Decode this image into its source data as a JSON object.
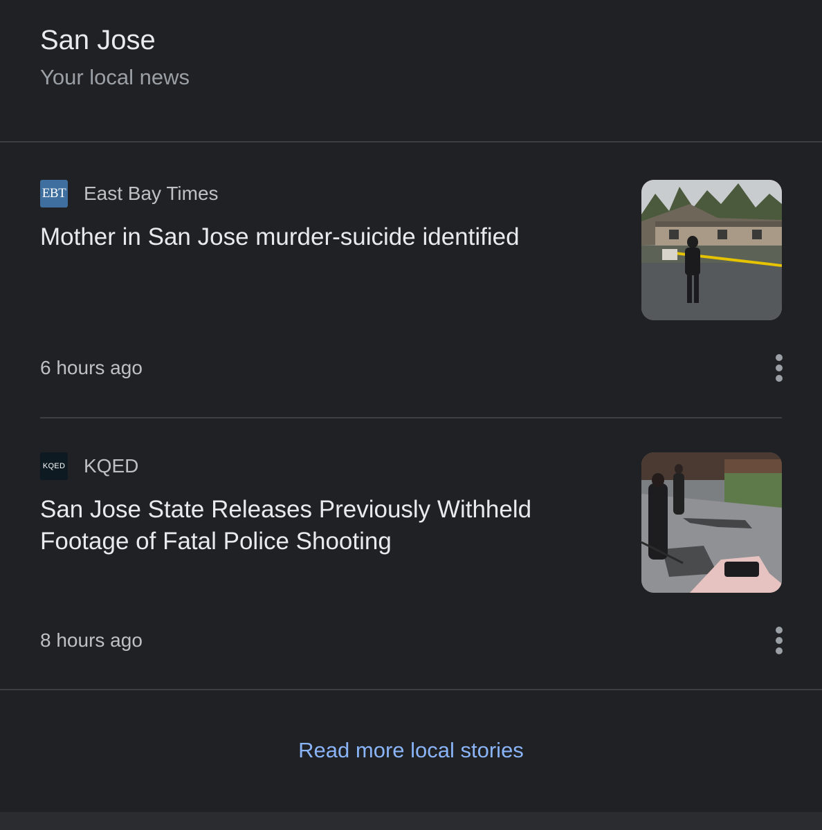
{
  "header": {
    "title": "San Jose",
    "subtitle": "Your local news"
  },
  "articles": [
    {
      "source_logo_text": "EBT",
      "source": "East Bay Times",
      "headline": "Mother in San Jose murder-suicide identified",
      "time": "6 hours ago",
      "thumbnail": "police-tape-apartment-scene"
    },
    {
      "source_logo_text": "KQED",
      "source": "KQED",
      "headline": "San Jose State Releases Previously Withheld Footage of Fatal Police Shooting",
      "time": "8 hours ago",
      "thumbnail": "bodycam-footage-still"
    }
  ],
  "footer": {
    "read_more": "Read more local stories"
  },
  "colors": {
    "background": "#202124",
    "text_primary": "#e8eaed",
    "text_secondary": "#bdc1c6",
    "link": "#8ab4f8"
  }
}
